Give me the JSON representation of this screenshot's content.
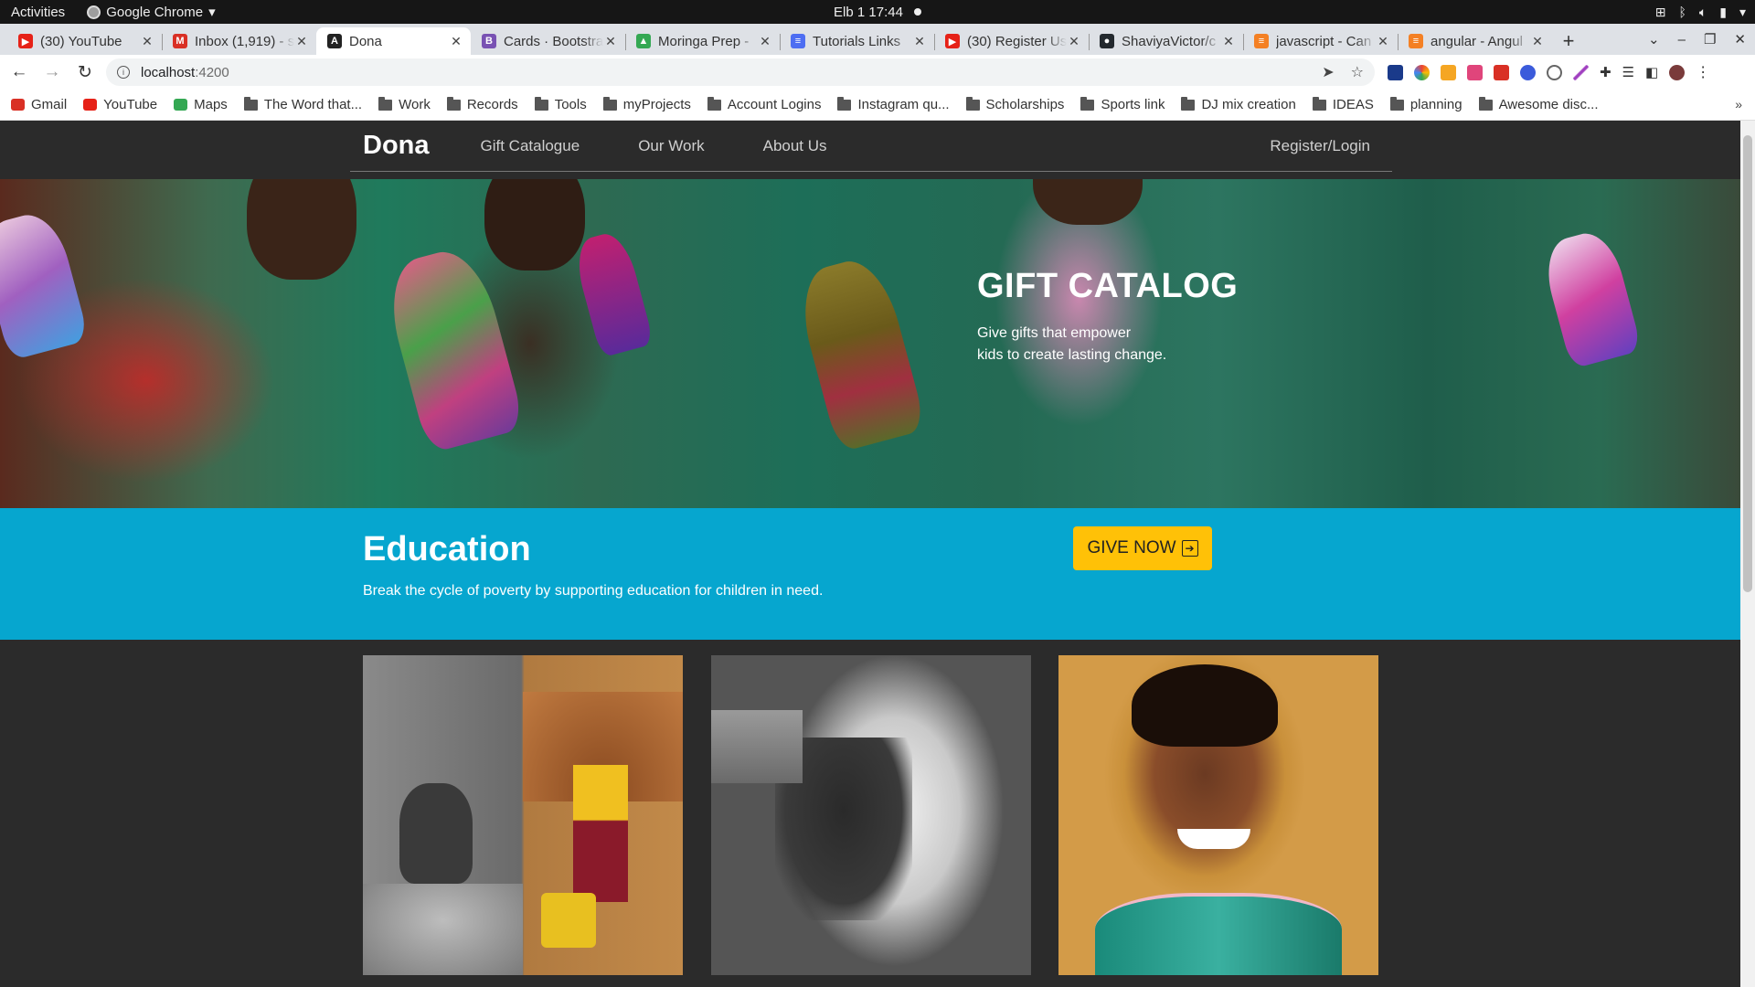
{
  "os_bar": {
    "activities": "Activities",
    "app_name": "Google Chrome",
    "clock": "Elb 1  17:44"
  },
  "tabs": [
    {
      "title": "(30) YouTube",
      "favicon_color": "#e62117",
      "favicon_glyph": "▶"
    },
    {
      "title": "Inbox (1,919) - s",
      "favicon_color": "#d93025",
      "favicon_glyph": "M"
    },
    {
      "title": "Dona",
      "favicon_color": "#222222",
      "favicon_glyph": "A"
    },
    {
      "title": "Cards · Bootstra",
      "favicon_color": "#7952b3",
      "favicon_glyph": "B"
    },
    {
      "title": "Moringa Prep -",
      "favicon_color": "#34a853",
      "favicon_glyph": "▲"
    },
    {
      "title": "Tutorials Links",
      "favicon_color": "#4e6ef2",
      "favicon_glyph": "≡"
    },
    {
      "title": "(30) Register Us",
      "favicon_color": "#e62117",
      "favicon_glyph": "▶"
    },
    {
      "title": "ShaviyaVictor/c",
      "favicon_color": "#24292e",
      "favicon_glyph": "●"
    },
    {
      "title": "javascript - Can",
      "favicon_color": "#f48024",
      "favicon_glyph": "≡"
    },
    {
      "title": "angular - Angul",
      "favicon_color": "#f48024",
      "favicon_glyph": "≡"
    }
  ],
  "address": {
    "host": "localhost",
    "port": ":4200"
  },
  "bookmarks": [
    {
      "label": "Gmail",
      "type": "site",
      "color": "#d93025"
    },
    {
      "label": "YouTube",
      "type": "site",
      "color": "#e62117"
    },
    {
      "label": "Maps",
      "type": "site",
      "color": "#34a853"
    },
    {
      "label": "The Word that...",
      "type": "folder"
    },
    {
      "label": "Work",
      "type": "folder"
    },
    {
      "label": "Records",
      "type": "folder"
    },
    {
      "label": "Tools",
      "type": "folder"
    },
    {
      "label": "myProjects",
      "type": "folder"
    },
    {
      "label": "Account Logins",
      "type": "folder"
    },
    {
      "label": "Instagram qu...",
      "type": "folder"
    },
    {
      "label": "Scholarships",
      "type": "folder"
    },
    {
      "label": "Sports link",
      "type": "folder"
    },
    {
      "label": "DJ mix creation",
      "type": "folder"
    },
    {
      "label": "IDEAS",
      "type": "folder"
    },
    {
      "label": "planning",
      "type": "folder"
    },
    {
      "label": "Awesome disc...",
      "type": "folder"
    }
  ],
  "site": {
    "brand": "Dona",
    "nav": [
      "Gift Catalogue",
      "Our Work",
      "About Us"
    ],
    "auth": "Register/Login",
    "hero": {
      "title": "GIFT CATALOG",
      "line1": "Give gifts that empower",
      "line2": "kids to create lasting change."
    },
    "education": {
      "title": "Education",
      "subtitle": "Break the cycle of poverty by supporting education for children in need.",
      "button": "GIVE NOW"
    }
  },
  "colors": {
    "accent_banner": "#06a6cf",
    "button": "#ffc107",
    "page_bg": "#2b2b2b"
  }
}
